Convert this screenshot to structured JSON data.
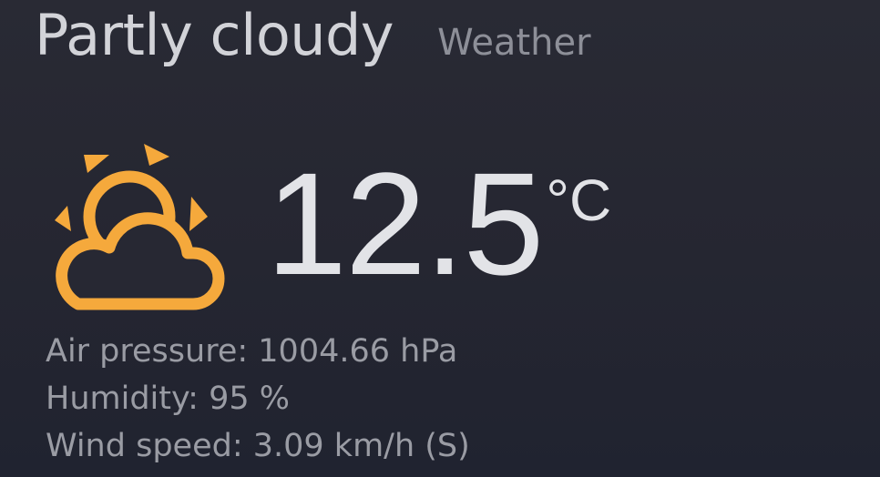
{
  "header": {
    "condition": "Partly cloudy",
    "source_label": "Weather"
  },
  "current": {
    "icon": "partly-cloudy-icon",
    "temperature": "12.5",
    "unit": "°C"
  },
  "details": {
    "pressure": "Air pressure: 1004.66 hPa",
    "humidity": "Humidity: 95 %",
    "wind": "Wind speed: 3.09 km/h (S)"
  },
  "colors": {
    "background": "#262733",
    "icon_accent": "#f5a93c",
    "primary_text": "#e2e3e7",
    "secondary_text": "#9a9ca4"
  }
}
